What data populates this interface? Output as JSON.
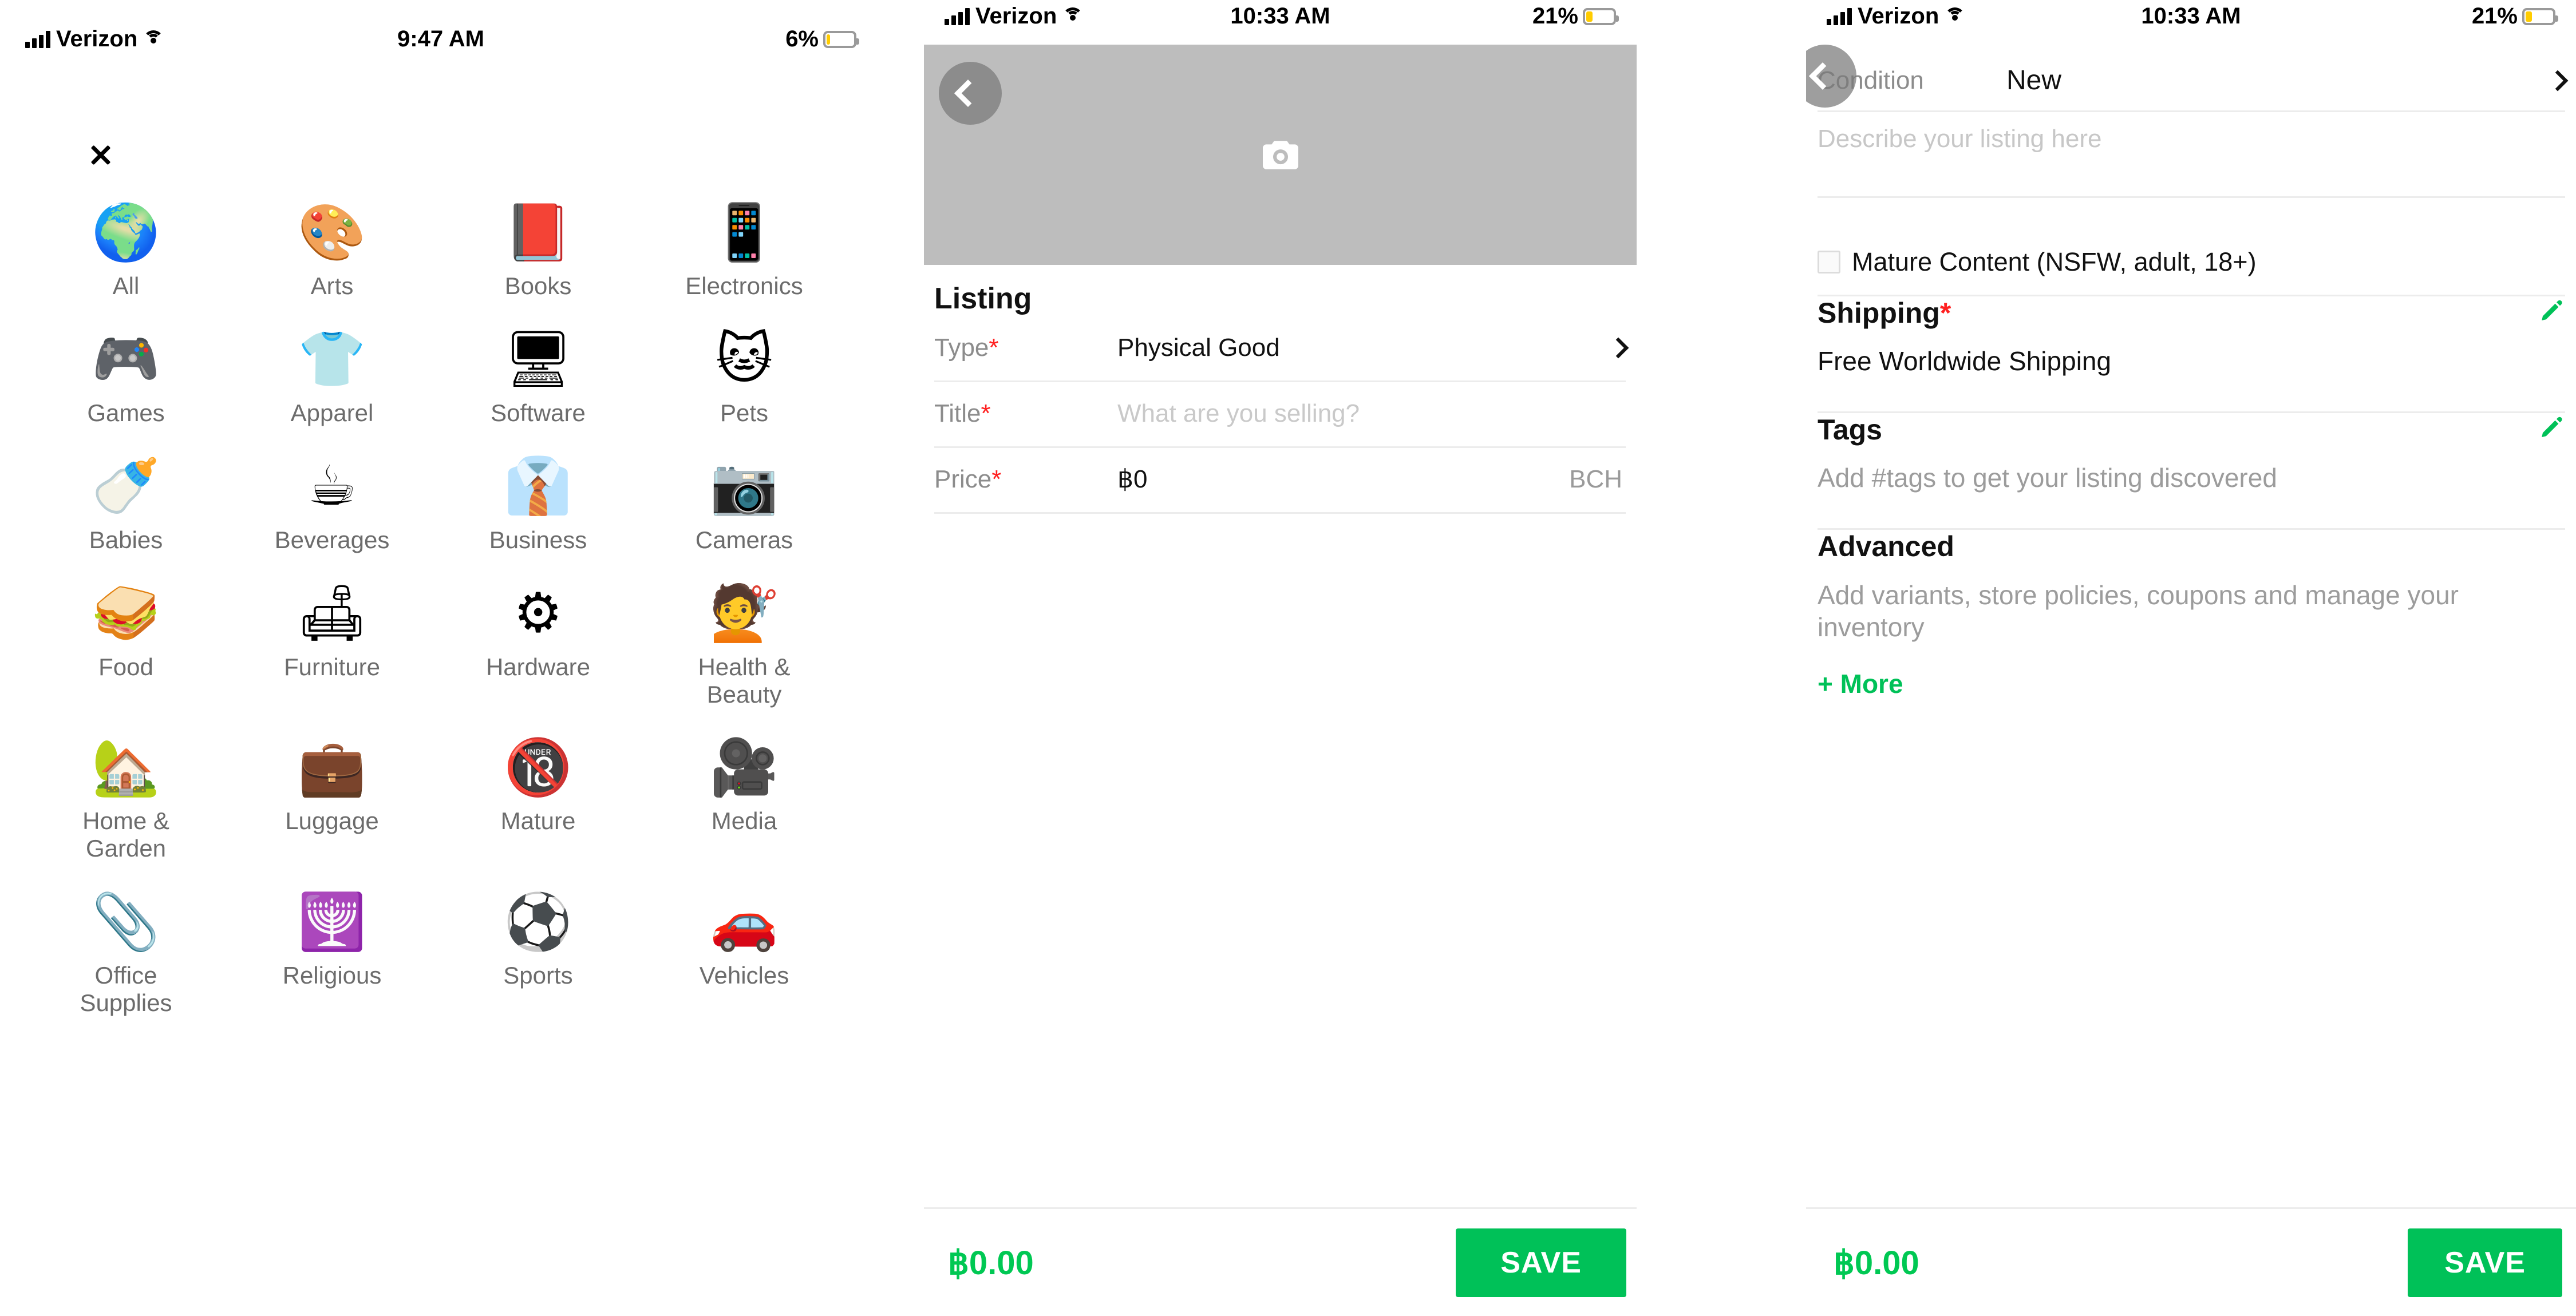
{
  "panels": {
    "categories": {
      "status": {
        "carrier": "Verizon",
        "time": "9:47 AM",
        "battery_pct": "6%",
        "battery_level": 6
      },
      "close_label": "close-icon",
      "items": [
        {
          "label": "All",
          "emoji": "🌍",
          "icon": "globe-icon"
        },
        {
          "label": "Arts",
          "emoji": "🎨",
          "icon": "palette-icon"
        },
        {
          "label": "Books",
          "emoji": "📕",
          "icon": "book-icon"
        },
        {
          "label": "Electronics",
          "emoji": "📱",
          "icon": "phone-icon"
        },
        {
          "label": "Games",
          "emoji": "🎮",
          "icon": "gamepad-icon"
        },
        {
          "label": "Apparel",
          "emoji": "👕",
          "icon": "tshirt-icon"
        },
        {
          "label": "Software",
          "emoji": "🖥",
          "icon": "monitor-icon"
        },
        {
          "label": "Pets",
          "emoji": "🐱",
          "icon": "cat-icon"
        },
        {
          "label": "Babies",
          "emoji": "🍼",
          "icon": "pacifier-icon"
        },
        {
          "label": "Beverages",
          "emoji": "☕",
          "icon": "coffee-icon"
        },
        {
          "label": "Business",
          "emoji": "👔",
          "icon": "necktie-icon"
        },
        {
          "label": "Cameras",
          "emoji": "📷",
          "icon": "camera-icon"
        },
        {
          "label": "Food",
          "emoji": "🥪",
          "icon": "sandwich-icon"
        },
        {
          "label": "Furniture",
          "emoji": "🛋",
          "icon": "couch-icon"
        },
        {
          "label": "Hardware",
          "emoji": "⚙",
          "icon": "gear-icon"
        },
        {
          "label": "Health & Beauty",
          "emoji": "💇",
          "icon": "hairdryer-icon"
        },
        {
          "label": "Home & Garden",
          "emoji": "🏡",
          "icon": "house-icon"
        },
        {
          "label": "Luggage",
          "emoji": "💼",
          "icon": "suitcase-icon"
        },
        {
          "label": "Mature",
          "emoji": "🔞",
          "icon": "eighteen-plus-icon"
        },
        {
          "label": "Media",
          "emoji": "🎥",
          "icon": "video-camera-icon"
        },
        {
          "label": "Office Supplies",
          "emoji": "📎",
          "icon": "paperclip-icon"
        },
        {
          "label": "Religious",
          "emoji": "🕎",
          "icon": "menorah-icon"
        },
        {
          "label": "Sports",
          "emoji": "⚽",
          "icon": "soccer-ball-icon"
        },
        {
          "label": "Vehicles",
          "emoji": "🚗",
          "icon": "car-icon"
        }
      ]
    },
    "listing": {
      "status": {
        "carrier": "Verizon",
        "time": "10:33 AM",
        "battery_pct": "21%",
        "battery_level": 21
      },
      "photo_placeholder_icon": "camera-icon",
      "section_title": "Listing",
      "rows": {
        "type": {
          "label": "Type",
          "required": "*",
          "value": "Physical Good"
        },
        "title": {
          "label": "Title",
          "required": "*",
          "placeholder": "What are you selling?"
        },
        "price": {
          "label": "Price",
          "required": "*",
          "value": "฿0",
          "unit": "BCH"
        }
      },
      "footer": {
        "total": "฿0.00",
        "save_label": "SAVE"
      }
    },
    "details": {
      "status": {
        "carrier": "Verizon",
        "time": "10:33 AM",
        "battery_pct": "21%",
        "battery_level": 21
      },
      "condition": {
        "label": "Condition",
        "value": "New"
      },
      "description": {
        "placeholder": "Describe your listing here"
      },
      "mature": {
        "label": "Mature Content (NSFW, adult, 18+)",
        "checked": false
      },
      "shipping": {
        "title": "Shipping",
        "required": "*",
        "value": "Free Worldwide Shipping",
        "edit_icon": "pencil-icon"
      },
      "tags": {
        "title": "Tags",
        "placeholder": "Add #tags to get your listing discovered",
        "edit_icon": "pencil-icon"
      },
      "advanced": {
        "title": "Advanced",
        "description": "Add variants, store policies, coupons and manage your inventory",
        "more_label": "+ More"
      },
      "footer": {
        "total": "฿0.00",
        "save_label": "SAVE"
      }
    }
  },
  "colors": {
    "brand_green": "#00c158",
    "total_green": "#00c853",
    "required_red": "#ff2020",
    "muted_gray": "#9c9c9c",
    "placeholder_gray": "#c7c7c7",
    "photo_placeholder": "#bdbdbd"
  }
}
